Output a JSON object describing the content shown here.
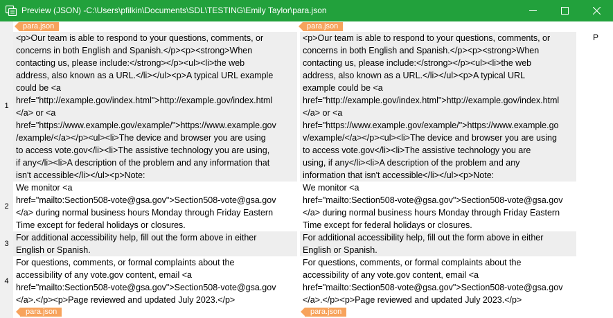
{
  "window": {
    "title": "Preview (JSON) -C:\\Users\\pfilkin\\Documents\\SDL\\TESTING\\Emily Taylor\\para.json",
    "accent": "#22a13c"
  },
  "tags": {
    "start_left": "para.json",
    "start_right": "para.json",
    "end_left": "para.json",
    "end_right": "para.json",
    "color": "#f7a35c"
  },
  "right_panel": {
    "letter": "P"
  },
  "segments": [
    {
      "number": "1",
      "source": [
        "<p>Our team is able to respond to your questions, comments, or",
        "concerns in both English and Spanish.</p><p><strong>When",
        "contacting us, please include:</strong></p><ul><li>the web",
        "address, also known as a URL.</li></ul><p>A typical URL example",
        "could be <a",
        "href=\"http://example.gov/index.html\">http://example.gov/index.html",
        "</a> or <a",
        "href=\"https://www.example.gov/example/\">https://www.example.gov",
        "/example/</a></p><ul><li>The device and browser you are using",
        "to access vote.gov</li><li>The assistive technology you are using,",
        "if any</li><li>A description of the problem and any information that",
        "isn't accessible</li></ul><p>Note:"
      ],
      "target": [
        "<p>Our team is able to respond to your questions, comments, or",
        "concerns in both English and Spanish.</p><p><strong>When",
        "contacting us, please include:</strong></p><ul><li>the web",
        "address, also known as a URL.</li></ul><p>A typical URL",
        "example could be <a",
        "href=\"http://example.gov/index.html\">http://example.gov/index.html",
        "</a> or <a",
        "href=\"https://www.example.gov/example/\">https://www.example.go",
        "v/example/</a></p><ul><li>The device and browser you are using",
        "to access vote.gov</li><li>The assistive technology you are",
        "using, if any</li><li>A description of the problem and any",
        "information that isn't accessible</li></ul><p>Note:"
      ]
    },
    {
      "number": "2",
      "source": [
        "We monitor <a",
        "href=\"mailto:Section508-vote@gsa.gov\">Section508-vote@gsa.gov",
        "</a> during normal business hours Monday through Friday Eastern",
        "Time except for federal holidays or closures."
      ],
      "target": [
        "We monitor <a",
        "href=\"mailto:Section508-vote@gsa.gov\">Section508-vote@gsa.gov",
        "</a> during normal business hours Monday through Friday Eastern",
        "Time except for federal holidays or closures."
      ]
    },
    {
      "number": "3",
      "source": [
        "For additional accessibility help, fill out the form above in either",
        "English or Spanish."
      ],
      "target": [
        "For additional accessibility help, fill out the form above in either",
        "English or Spanish."
      ]
    },
    {
      "number": "4",
      "source": [
        "For questions, comments, or formal complaints about the",
        "accessibility of any vote.gov content, email <a",
        "href=\"mailto:Section508-vote@gsa.gov\">Section508-vote@gsa.gov",
        "</a>.</p><p>Page reviewed and updated July 2023.</p>"
      ],
      "target": [
        "For questions, comments, or formal complaints about the",
        "accessibility of any vote.gov content, email <a",
        "href=\"mailto:Section508-vote@gsa.gov\">Section508-vote@gsa.gov",
        "</a>.</p><p>Page reviewed and updated July 2023.</p>"
      ]
    }
  ]
}
